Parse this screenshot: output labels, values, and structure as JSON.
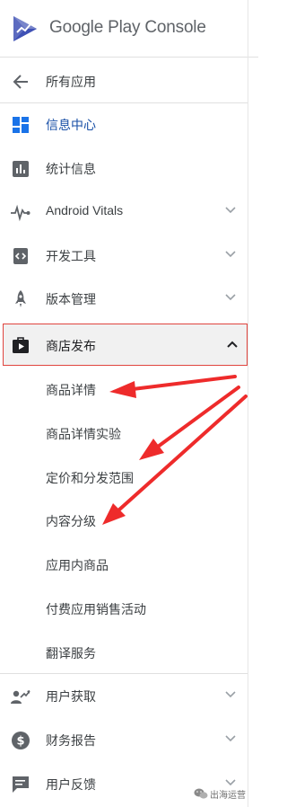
{
  "header": {
    "brand": "Google Play Console"
  },
  "nav": {
    "back": {
      "label": "所有应用",
      "icon": "arrow-back-icon"
    },
    "dashboard": {
      "label": "信息中心",
      "icon": "dashboard-icon"
    },
    "statistics": {
      "label": "统计信息",
      "icon": "bar-chart-icon"
    },
    "vitals": {
      "label": "Android Vitals",
      "icon": "vitals-pulse-icon"
    },
    "dev_tools": {
      "label": "开发工具",
      "icon": "code-icon"
    },
    "release": {
      "label": "版本管理",
      "icon": "rocket-icon"
    },
    "store": {
      "label": "商店发布",
      "icon": "store-bag-icon"
    },
    "acquisition": {
      "label": "用户获取",
      "icon": "user-trend-icon"
    },
    "financial": {
      "label": "财务报告",
      "icon": "dollar-icon"
    },
    "feedback": {
      "label": "用户反馈",
      "icon": "chat-icon"
    }
  },
  "store_sub": [
    {
      "label": "商品详情"
    },
    {
      "label": "商品详情实验"
    },
    {
      "label": "定价和分发范围"
    },
    {
      "label": "内容分级"
    },
    {
      "label": "应用内商品"
    },
    {
      "label": "付费应用销售活动"
    },
    {
      "label": "翻译服务"
    }
  ],
  "watermark": {
    "text": "出海运营"
  },
  "colors": {
    "active_blue": "#1a73e8",
    "highlight_red": "#e0443e",
    "icon_grey": "#5f6368",
    "arrow_red": "#ee2b2b"
  }
}
